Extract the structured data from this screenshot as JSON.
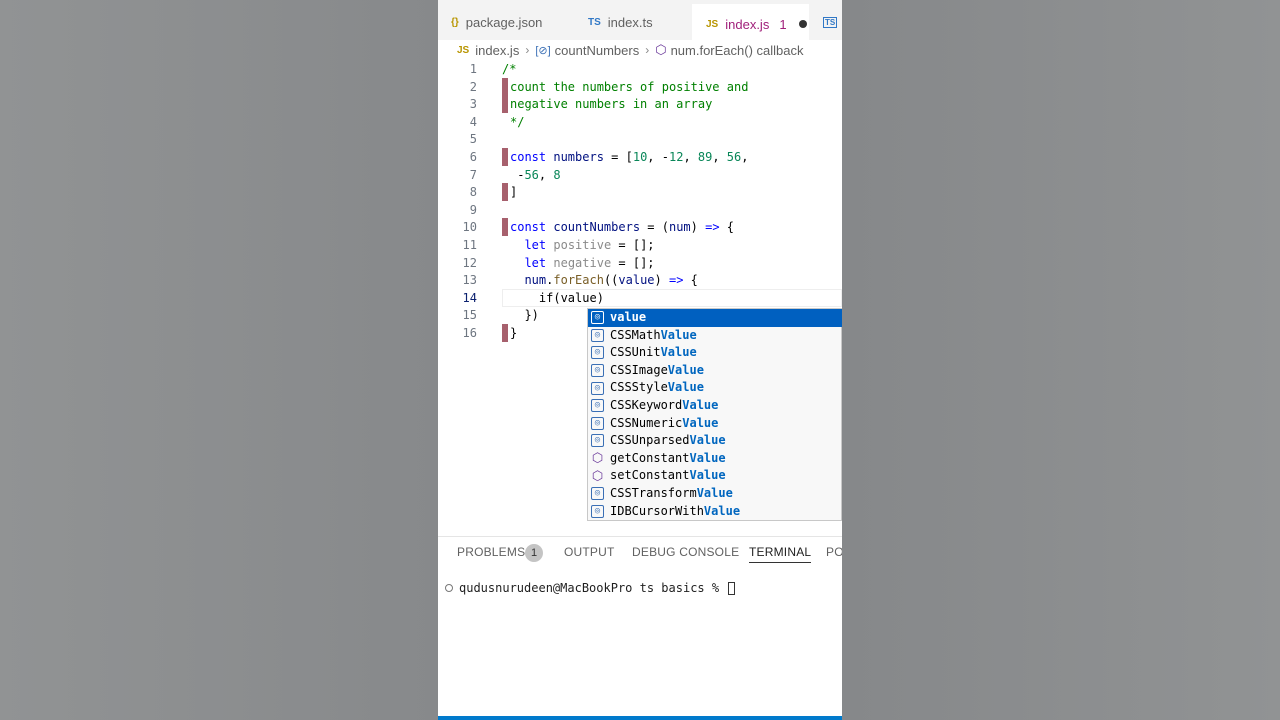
{
  "tabs": [
    {
      "icon": "{}",
      "label": "package.json",
      "icon_color": "#b89500"
    },
    {
      "icon": "TS",
      "label": "index.ts",
      "icon_color": "#3178c6"
    },
    {
      "icon": "JS",
      "label": "index.js",
      "badge": "1",
      "icon_color": "#b89500",
      "active": true,
      "dirty": true
    },
    {
      "icon": "TS",
      "label": "",
      "icon_color": "#3178c6"
    }
  ],
  "breadcrumb": {
    "file": "index.js",
    "symbol": "countNumbers",
    "callback": "num.forEach() callback"
  },
  "editor": {
    "line_numbers": [
      "1",
      "2",
      "3",
      "4",
      "5",
      "6",
      "7",
      "8",
      "9",
      "10",
      "11",
      "12",
      "13",
      "14",
      "15",
      "16"
    ],
    "typed_text": "if(value)"
  },
  "suggestions": [
    {
      "prefix": "",
      "match": "value",
      "kind": "variable"
    },
    {
      "prefix": "CSSMath",
      "match": "Value",
      "kind": "variable"
    },
    {
      "prefix": "CSSUnit",
      "match": "Value",
      "kind": "variable"
    },
    {
      "prefix": "CSSImage",
      "match": "Value",
      "kind": "variable"
    },
    {
      "prefix": "CSSStyle",
      "match": "Value",
      "kind": "variable"
    },
    {
      "prefix": "CSSKeyword",
      "match": "Value",
      "kind": "variable"
    },
    {
      "prefix": "CSSNumeric",
      "match": "Value",
      "kind": "variable"
    },
    {
      "prefix": "CSSUnparsed",
      "match": "Value",
      "kind": "variable"
    },
    {
      "prefix": "getConstant",
      "match": "Value",
      "kind": "method"
    },
    {
      "prefix": "setConstant",
      "match": "Value",
      "kind": "method"
    },
    {
      "prefix": "CSSTransform",
      "match": "Value",
      "kind": "variable"
    },
    {
      "prefix": "IDBCursorWith",
      "match": "Value",
      "kind": "variable"
    }
  ],
  "panel": {
    "tabs": [
      "PROBLEMS",
      "OUTPUT",
      "DEBUG CONSOLE",
      "TERMINAL",
      "PO"
    ],
    "problems_count": "1",
    "active_tab": "TERMINAL",
    "terminal_prompt": "qudusnurudeen@MacBookPro ts basics % "
  },
  "colors": {
    "accent": "#007acc",
    "selection": "#0060c0",
    "modified_gutter": "#a7606d",
    "active_tab_text": "#a01f7a"
  }
}
